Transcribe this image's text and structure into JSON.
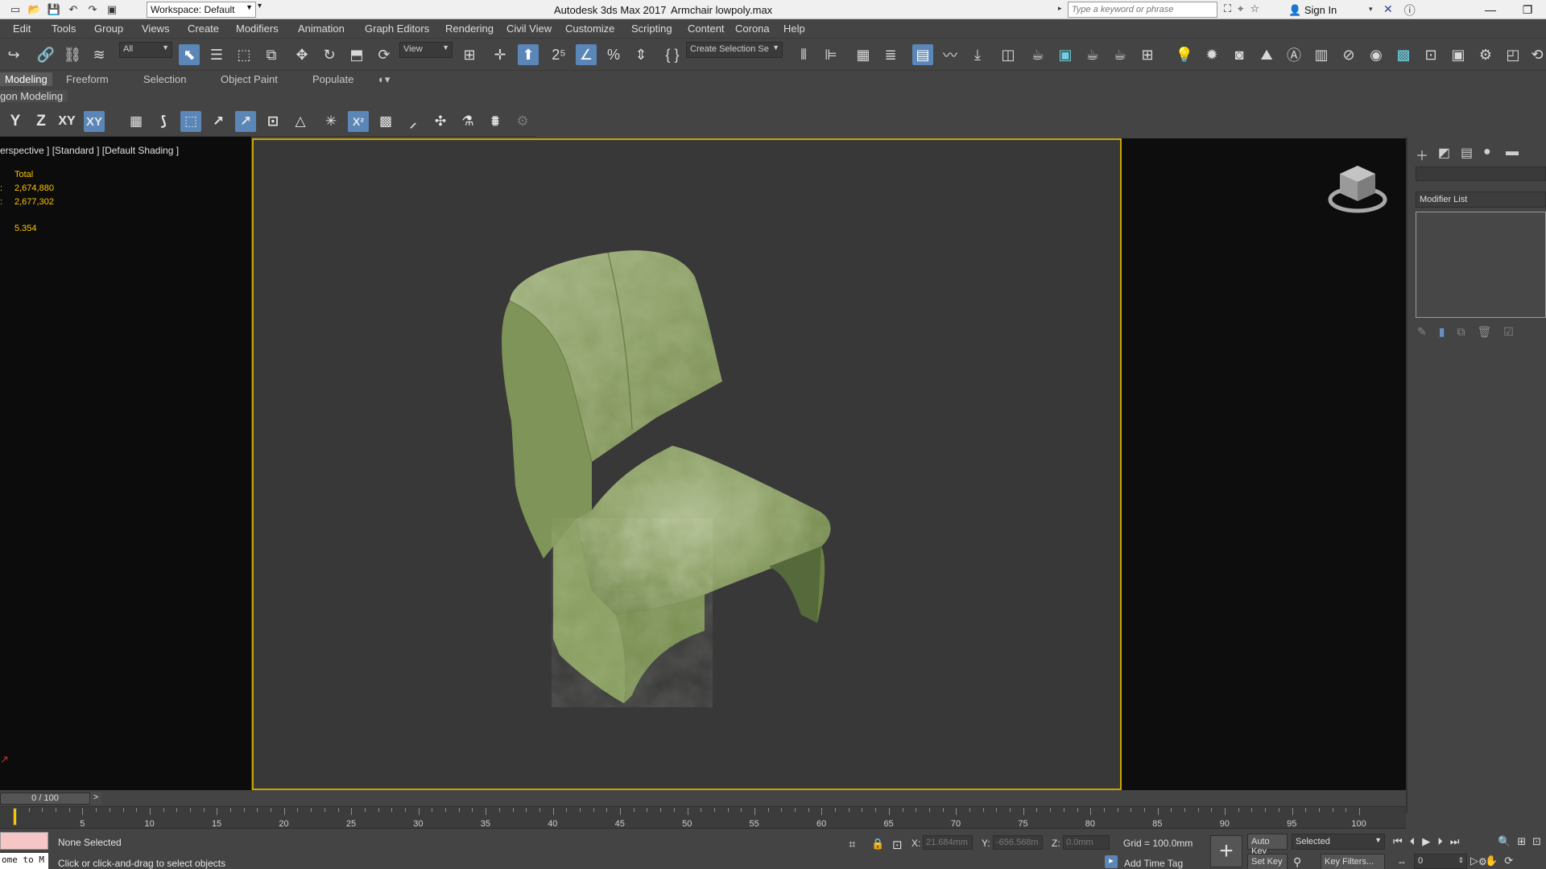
{
  "titlebar": {
    "workspace": "Workspace: Default",
    "app_title": "Autodesk 3ds Max 2017",
    "file_title": "Armchair lowpoly.max",
    "search_placeholder": "Type a keyword or phrase",
    "signin": "Sign In"
  },
  "menu": [
    "Edit",
    "Tools",
    "Group",
    "Views",
    "Create",
    "Modifiers",
    "Animation",
    "Graph Editors",
    "Rendering",
    "Civil View",
    "Customize",
    "Scripting",
    "Content",
    "Corona",
    "Help"
  ],
  "maintoolbar": {
    "selection_filter": "All",
    "ref_coord": "View",
    "named_selection": "Create Selection Se"
  },
  "ribbon": {
    "tabs": [
      "Modeling",
      "Freeform",
      "Selection",
      "Object Paint",
      "Populate"
    ],
    "panel_title": "gon Modeling"
  },
  "axis": {
    "y": "Y",
    "z": "Z",
    "xy": "XY",
    "xy_active": "XY"
  },
  "viewport": {
    "label": "erspective ] [Standard ] [Default Shading ]",
    "stats": {
      "total_label": "Total",
      "polys_prefix": ":",
      "polys": "2,674,880",
      "verts_prefix": ":",
      "verts": "2,677,302",
      "fps": "5.354"
    }
  },
  "command_panel": {
    "modifier_list": "Modifier List"
  },
  "timeline": {
    "slider_label": "0 / 100",
    "next": ">",
    "ticks": [
      "5",
      "10",
      "15",
      "20",
      "25",
      "30",
      "35",
      "40",
      "45",
      "50",
      "55",
      "60",
      "65",
      "70",
      "75",
      "80",
      "85",
      "90",
      "95",
      "100"
    ]
  },
  "status": {
    "maxscript": "ome to M",
    "selection": "None Selected",
    "prompt": "Click or click-and-drag to select objects",
    "x_label": "X:",
    "x_value": "21.684mm",
    "y_label": "Y:",
    "y_value": "-656.568m",
    "z_label": "Z:",
    "z_value": "0.0mm",
    "grid": "Grid = 100.0mm",
    "add_time_tag": "Add Time Tag",
    "auto_key": "Auto Key",
    "set_key": "Set Key",
    "key_mode": "Selected",
    "key_filters": "Key Filters...",
    "frame": "0"
  },
  "colors": {
    "viewport_border": "#c9a400",
    "stat_text": "#ffc400",
    "active_button": "#5b86b8"
  }
}
